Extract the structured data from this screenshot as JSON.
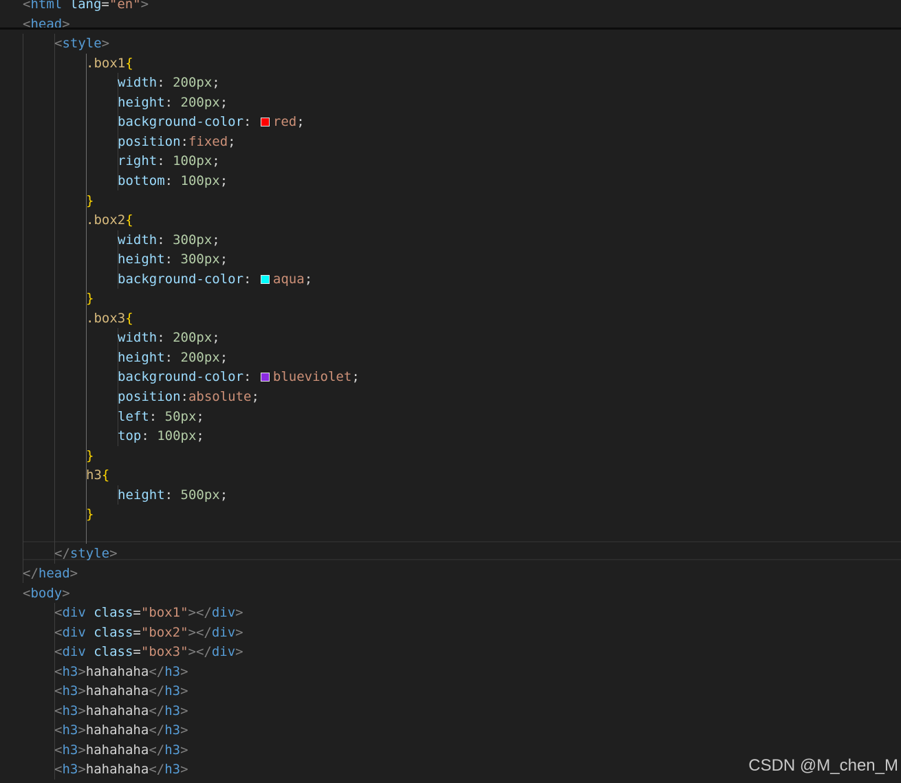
{
  "code": {
    "html_open_partial": "html lang=\"en\"",
    "head": "head",
    "style": "style",
    "rules": [
      {
        "selector": ".box1",
        "decls": [
          {
            "prop": "width",
            "sep": ": ",
            "value": "200px",
            "kind": "num"
          },
          {
            "prop": "height",
            "sep": ": ",
            "value": "200px",
            "kind": "num"
          },
          {
            "prop": "background-color",
            "sep": ": ",
            "value": "red",
            "kind": "kw",
            "swatch": "#ff0000"
          },
          {
            "prop": "position",
            "sep": ":",
            "value": "fixed",
            "kind": "kw"
          },
          {
            "prop": "right",
            "sep": ": ",
            "value": "100px",
            "kind": "num"
          },
          {
            "prop": "bottom",
            "sep": ": ",
            "value": "100px",
            "kind": "num"
          }
        ]
      },
      {
        "selector": ".box2",
        "decls": [
          {
            "prop": "width",
            "sep": ": ",
            "value": "300px",
            "kind": "num"
          },
          {
            "prop": "height",
            "sep": ": ",
            "value": "300px",
            "kind": "num"
          },
          {
            "prop": "background-color",
            "sep": ": ",
            "value": "aqua",
            "kind": "kw",
            "swatch": "#00ffff"
          }
        ]
      },
      {
        "selector": ".box3",
        "decls": [
          {
            "prop": "width",
            "sep": ": ",
            "value": "200px",
            "kind": "num"
          },
          {
            "prop": "height",
            "sep": ": ",
            "value": "200px",
            "kind": "num"
          },
          {
            "prop": "background-color",
            "sep": ": ",
            "value": "blueviolet",
            "kind": "kw",
            "swatch": "#8a2be2"
          },
          {
            "prop": "position",
            "sep": ":",
            "value": "absolute",
            "kind": "kw"
          },
          {
            "prop": "left",
            "sep": ": ",
            "value": "50px",
            "kind": "num"
          },
          {
            "prop": "top",
            "sep": ": ",
            "value": "100px",
            "kind": "num"
          }
        ]
      },
      {
        "selector": "h3",
        "decls": [
          {
            "prop": "height",
            "sep": ": ",
            "value": "500px",
            "kind": "num"
          }
        ]
      }
    ],
    "body": "body",
    "divs": [
      {
        "tag": "div",
        "attr": "class",
        "value": "\"box1\""
      },
      {
        "tag": "div",
        "attr": "class",
        "value": "\"box2\""
      },
      {
        "tag": "div",
        "attr": "class",
        "value": "\"box3\""
      }
    ],
    "headings": [
      {
        "tag": "h3",
        "text": "hahahaha"
      },
      {
        "tag": "h3",
        "text": "hahahaha"
      },
      {
        "tag": "h3",
        "text": "hahahaha"
      },
      {
        "tag": "h3",
        "text": "hahahaha"
      },
      {
        "tag": "h3",
        "text": "hahahaha"
      },
      {
        "tag": "h3",
        "text": "hahahaha"
      }
    ]
  },
  "watermark": "CSDN @M_chen_M"
}
